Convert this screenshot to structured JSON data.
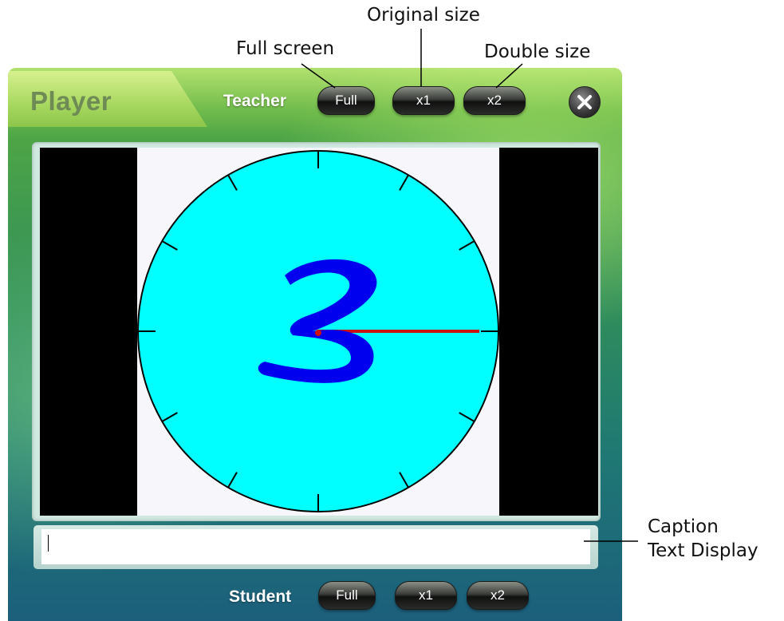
{
  "annotations": {
    "original_size": "Original size",
    "full_screen": "Full screen",
    "double_size": "Double size",
    "caption_line1": "Caption",
    "caption_line2": "Text Display"
  },
  "player": {
    "title": "Player",
    "teacher": {
      "label": "Teacher",
      "buttons": {
        "full": "Full",
        "x1": "x1",
        "x2": "x2"
      }
    },
    "student": {
      "label": "Student",
      "buttons": {
        "full": "Full",
        "x1": "x1",
        "x2": "x2"
      }
    },
    "close_icon": "close-icon",
    "caption_text": ""
  },
  "video": {
    "clock_face_color": "#00ffff",
    "digit_color": "#0000ee",
    "hand_color": "#cc1111",
    "handwritten_digit": "3",
    "tick_count": 12
  },
  "colors": {
    "accent_green": "#7dbc3f",
    "accent_teal": "#1c5f7c"
  }
}
